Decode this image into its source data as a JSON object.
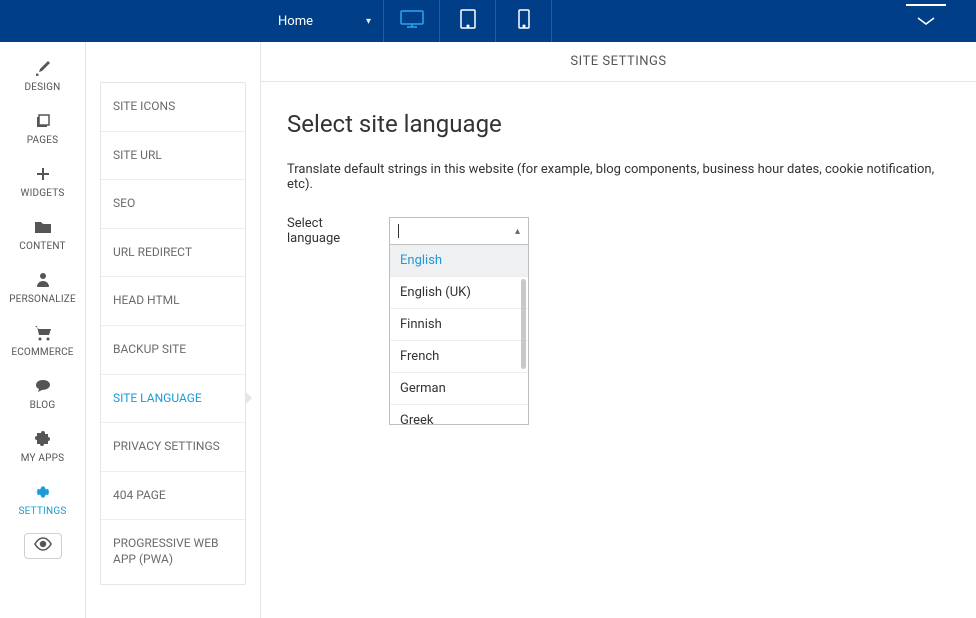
{
  "topbar": {
    "page_select_label": "Home"
  },
  "left_rail": {
    "items": [
      {
        "label": "DESIGN"
      },
      {
        "label": "PAGES"
      },
      {
        "label": "WIDGETS"
      },
      {
        "label": "CONTENT"
      },
      {
        "label": "PERSONALIZE"
      },
      {
        "label": "ECOMMERCE"
      },
      {
        "label": "BLOG"
      },
      {
        "label": "MY APPS"
      },
      {
        "label": "SETTINGS"
      }
    ]
  },
  "sub_panel": {
    "items": [
      {
        "label": "SITE ICONS"
      },
      {
        "label": "SITE URL"
      },
      {
        "label": "SEO"
      },
      {
        "label": "URL REDIRECT"
      },
      {
        "label": "HEAD HTML"
      },
      {
        "label": "BACKUP SITE"
      },
      {
        "label": "SITE LANGUAGE"
      },
      {
        "label": "PRIVACY SETTINGS"
      },
      {
        "label": "404 PAGE"
      },
      {
        "label": "PROGRESSIVE WEB APP (PWA)"
      }
    ]
  },
  "main": {
    "header": "SITE SETTINGS",
    "title": "Select site language",
    "description": "Translate default strings in this website (for example, blog components, business hour dates, cookie notification, etc).",
    "field_label": "Select language",
    "dropdown_options": [
      {
        "label": "English"
      },
      {
        "label": "English (UK)"
      },
      {
        "label": "Finnish"
      },
      {
        "label": "French"
      },
      {
        "label": "German"
      },
      {
        "label": "Greek"
      }
    ]
  }
}
